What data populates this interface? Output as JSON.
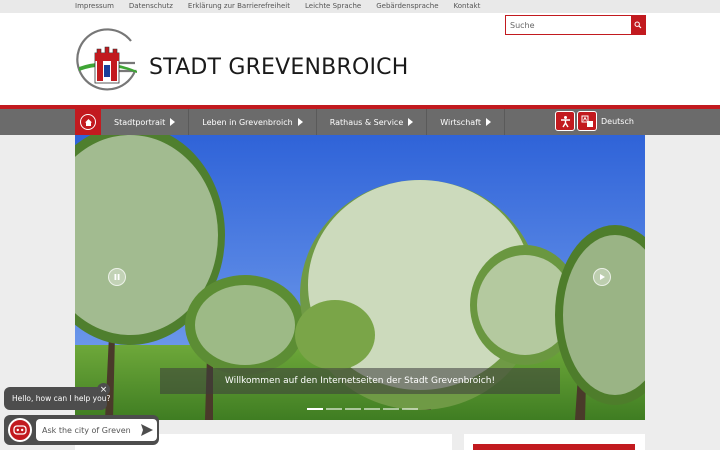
{
  "topbar": {
    "links": [
      "Impressum",
      "Datenschutz",
      "Erklärung zur Barrierefreiheit",
      "Leichte Sprache",
      "Gebärdensprache",
      "Kontakt"
    ]
  },
  "header": {
    "site_title": "STADT GREVENBROICH",
    "search_placeholder": "Suche"
  },
  "nav": {
    "items": [
      {
        "label": "Stadtportrait"
      },
      {
        "label": "Leben in Grevenbroich"
      },
      {
        "label": "Rathaus & Service"
      },
      {
        "label": "Wirtschaft"
      }
    ],
    "language": "Deutsch"
  },
  "hero": {
    "caption": "Willkommen auf den Internetseiten der Stadt Grevenbroich!",
    "slide_count": 6,
    "active_slide": 1
  },
  "chat": {
    "greeting": "Hello, how can I help you?",
    "close_symbol": "×",
    "input_placeholder": "Ask the city of Greven"
  },
  "colors": {
    "brand_red": "#c21a1f",
    "nav_gray": "#6b6b6b"
  }
}
